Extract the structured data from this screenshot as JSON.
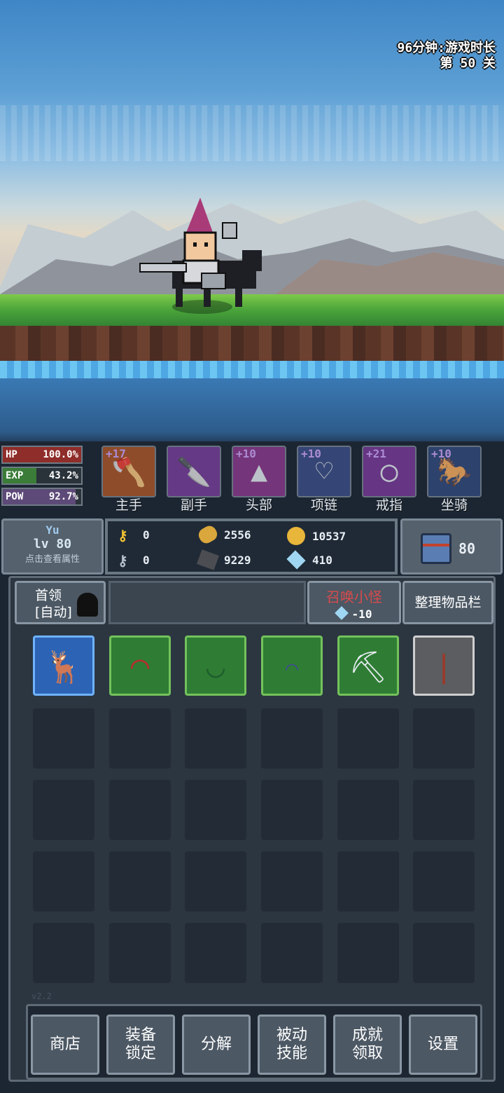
{
  "hud": {
    "play_time": "96分钟:游戏时长",
    "stage": "第 50 关"
  },
  "stats": [
    {
      "key": "HP",
      "value": "100.0%"
    },
    {
      "key": "EXP",
      "value": "43.2%"
    },
    {
      "key": "POW",
      "value": "92.7%"
    }
  ],
  "equipment": [
    {
      "level": "+17",
      "label": "主手",
      "icon": "axe-icon",
      "color": "#b0572a"
    },
    {
      "level": "",
      "label": "副手",
      "icon": "cleaver-icon",
      "color": "#7a3f9c"
    },
    {
      "level": "+10",
      "label": "头部",
      "icon": "wizard-hat-icon",
      "color": "#8e3a8e"
    },
    {
      "level": "+10",
      "label": "项链",
      "icon": "necklace-icon",
      "color": "#3d4f8a"
    },
    {
      "level": "+21",
      "label": "戒指",
      "icon": "ring-icon",
      "color": "#7b3a9a"
    },
    {
      "level": "+10",
      "label": "坐骑",
      "icon": "horse-icon",
      "color": "#334a7c"
    }
  ],
  "player": {
    "name": "Yu",
    "level": "lv 80",
    "hint": "点击查看属性"
  },
  "currency": {
    "gold_keys": "0",
    "silver_keys": "0",
    "bread": "2556",
    "iron": "9229",
    "coins": "10537",
    "crystals": "410"
  },
  "chest": {
    "count": "80"
  },
  "inventory_header": {
    "boss_line1": "首领",
    "boss_line2": "[自动]",
    "summon_title": "召唤小怪",
    "summon_cost": "-10",
    "sort_label": "整理物品栏"
  },
  "inventory_items": [
    {
      "icon": "deer-icon",
      "rarity": "blue"
    },
    {
      "icon": "red-hat-icon",
      "rarity": "green"
    },
    {
      "icon": "green-cap-icon",
      "rarity": "green"
    },
    {
      "icon": "helmet-icon",
      "rarity": "green"
    },
    {
      "icon": "pickaxe-icon",
      "rarity": "green"
    },
    {
      "icon": "torch-icon",
      "rarity": "gray"
    }
  ],
  "version": "v2.2",
  "toolbar": [
    {
      "label": "商店"
    },
    {
      "label": "装备\n锁定"
    },
    {
      "label": "分解"
    },
    {
      "label": "被动\n技能"
    },
    {
      "label": "成就\n领取"
    },
    {
      "label": "设置"
    }
  ]
}
